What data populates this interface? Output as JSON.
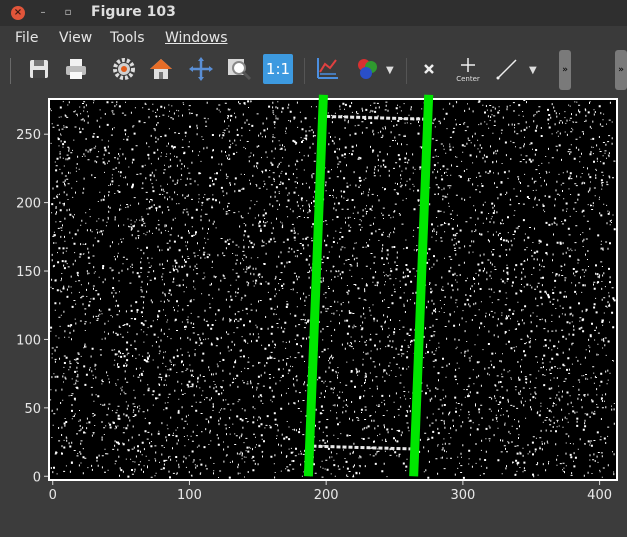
{
  "window": {
    "title": "Figure 103"
  },
  "menubar": {
    "items": [
      "File",
      "View",
      "Tools",
      "Windows"
    ]
  },
  "toolbar": {
    "buttons": [
      "save-icon",
      "print-icon",
      "settings-icon",
      "home-icon",
      "pan-icon",
      "zoom-icon",
      "one-to-one",
      "axes-edit-icon",
      "colors-icon",
      "delete-icon",
      "center-icon",
      "line-tool-icon"
    ],
    "one_to_one_label": "1:1",
    "center_label": "Center",
    "overflow_label": "»"
  },
  "chart_data": {
    "type": "image",
    "x_ticks": [
      0,
      100,
      200,
      300,
      400
    ],
    "y_ticks": [
      0,
      50,
      100,
      150,
      200,
      250
    ],
    "xlim": [
      -2,
      412
    ],
    "ylim": [
      -2,
      275
    ],
    "background": "#000000",
    "noise_color": "#ffffff",
    "lines_color": "#00e600",
    "lines": [
      {
        "points": [
          [
            187,
            0
          ],
          [
            198,
            270
          ]
        ]
      },
      {
        "points": [
          [
            264,
            0
          ],
          [
            275,
            270
          ]
        ]
      }
    ],
    "faint_strips": [
      {
        "points": [
          [
            190,
            22
          ],
          [
            262,
            20
          ]
        ]
      },
      {
        "points": [
          [
            200,
            263
          ],
          [
            272,
            261
          ]
        ]
      }
    ]
  }
}
